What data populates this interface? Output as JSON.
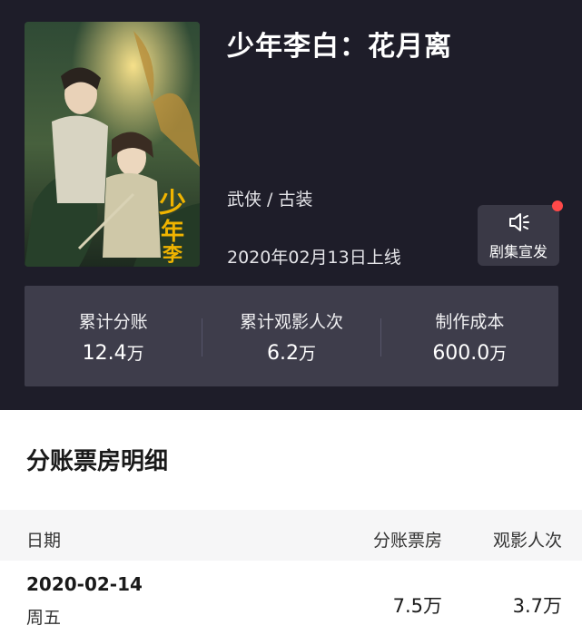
{
  "movie": {
    "title": "少年李白：花月离",
    "genre": "武侠 / 古装",
    "release": "2020年02月13日上线",
    "poster_icon": "movie-poster-image"
  },
  "promo": {
    "label": "剧集宣发",
    "icon": "megaphone-icon",
    "badge_color": "#ff4949"
  },
  "stats": [
    {
      "label": "累计分账",
      "number": "12.4",
      "unit": "万"
    },
    {
      "label": "累计观影人次",
      "number": "6.2",
      "unit": "万"
    },
    {
      "label": "制作成本",
      "number": "600.0",
      "unit": "万"
    }
  ],
  "detail": {
    "title": "分账票房明细",
    "columns": {
      "date": "日期",
      "box_office": "分账票房",
      "viewers": "观影人次"
    },
    "rows": [
      {
        "date": "2020-02-14",
        "weekday": "周五",
        "box_office": "7.5万",
        "viewers": "3.7万"
      }
    ]
  },
  "colors": {
    "header_bg": "#1e1d29",
    "stats_bg": "#3e3d4b",
    "accent_red": "#ff4949"
  }
}
